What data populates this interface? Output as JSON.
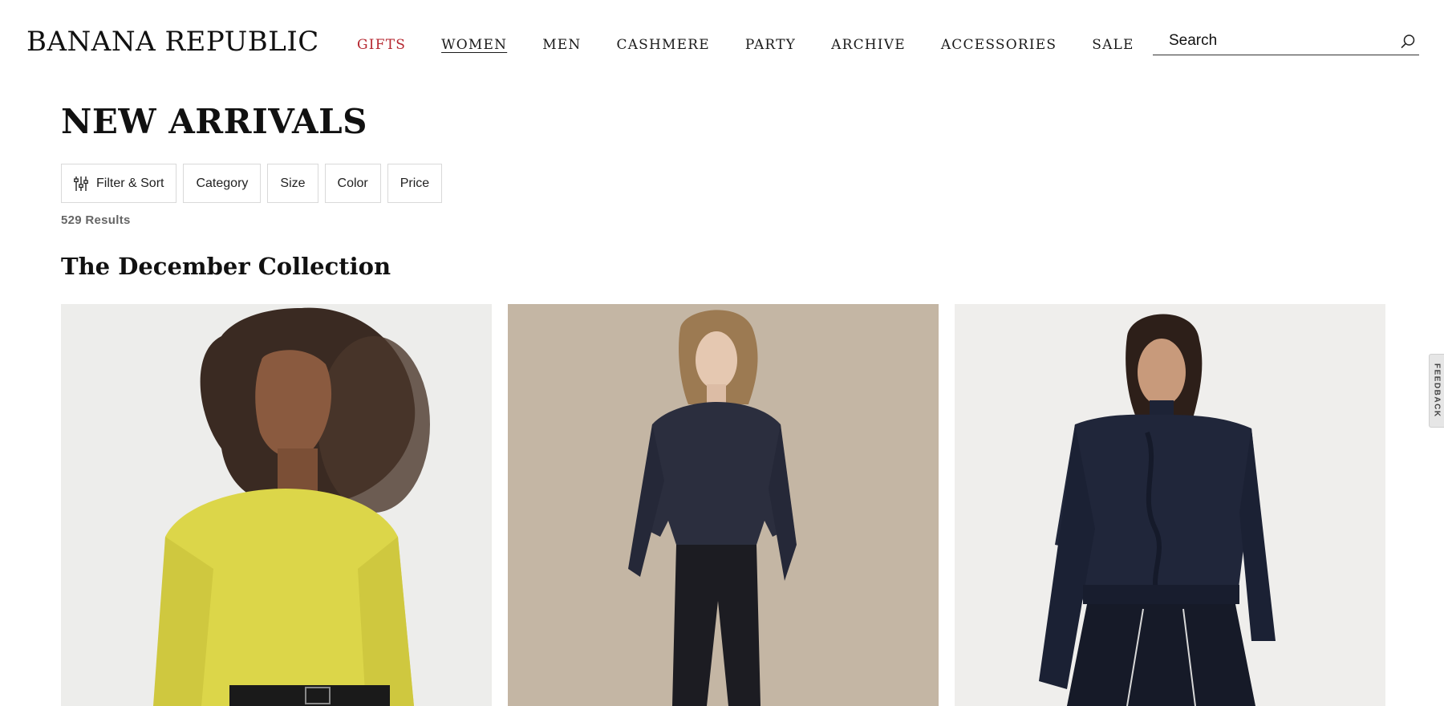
{
  "header": {
    "logo": "BANANA REPUBLIC",
    "nav": [
      {
        "label": "GIFTS",
        "color": "#b5262f"
      },
      {
        "label": "WOMEN",
        "active": true
      },
      {
        "label": "MEN"
      },
      {
        "label": "CASHMERE"
      },
      {
        "label": "PARTY"
      },
      {
        "label": "ARCHIVE"
      },
      {
        "label": "ACCESSORIES"
      },
      {
        "label": "SALE"
      }
    ],
    "search": {
      "placeholder": "Search",
      "icon": "search-icon"
    }
  },
  "main": {
    "title": "NEW ARRIVALS",
    "filters": [
      {
        "label": "Filter & Sort",
        "icon": "sliders-icon"
      },
      {
        "label": "Category"
      },
      {
        "label": "Size"
      },
      {
        "label": "Color"
      },
      {
        "label": "Price"
      }
    ],
    "results": "529 Results",
    "section_title": "The December Collection",
    "products": [
      {
        "image": "model-yellow-sweater",
        "background": "#ededeb"
      },
      {
        "image": "model-navy-satin-shirt-velvet-pants",
        "background": "#c7b9a8"
      },
      {
        "image": "model-navy-cable-knit-sweater",
        "background": "#efeeec"
      }
    ]
  },
  "feedback": {
    "label": "FEEDBACK"
  }
}
